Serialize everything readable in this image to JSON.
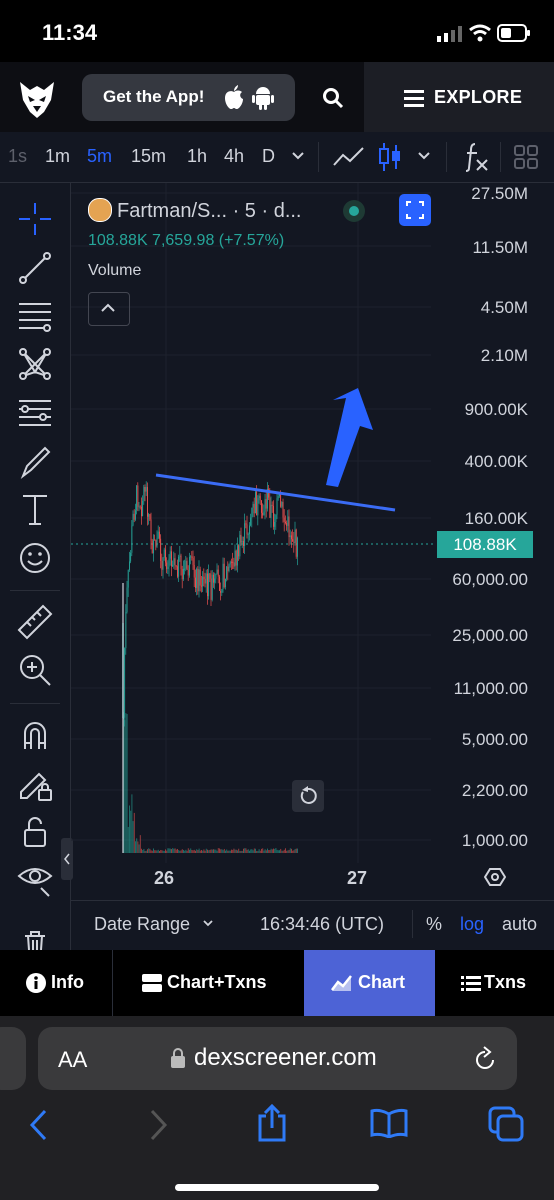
{
  "status_bar": {
    "time": "11:34"
  },
  "header": {
    "get_app_label": "Get the App!",
    "explore_label": "EXPLORE"
  },
  "timeframes": [
    "1s",
    "1m",
    "5m",
    "15m",
    "1h",
    "4h",
    "D"
  ],
  "active_timeframe": "5m",
  "chart": {
    "symbol_title": "Fartman/S... · 5 · d...",
    "value_line": "108.88K  7,659.98 (+7.57%)",
    "volume_label": "Volume",
    "current_price_label": "108.88K",
    "y_tick_labels": [
      "27.50M",
      "11.50M",
      "4.50M",
      "2.10M",
      "900.00K",
      "400.00K",
      "160.00K",
      "60,000.00",
      "25,000.00",
      "11,000.00",
      "5,000.00",
      "2,200.00",
      "1,000.00"
    ],
    "x_tick_labels": [
      "26",
      "27"
    ],
    "accent_color": "#2962ff",
    "up_color": "#26a69a",
    "down_color": "#ef5350"
  },
  "chart_footer": {
    "date_range_label": "Date Range",
    "time_label": "16:34:46 (UTC)",
    "percent_label": "%",
    "log_label": "log",
    "auto_label": "auto"
  },
  "tabs": [
    {
      "label": "Info",
      "icon": "info-icon"
    },
    {
      "label": "Chart+Txns",
      "icon": "split-icon"
    },
    {
      "label": "Chart",
      "icon": "chart-icon",
      "active": true
    },
    {
      "label": "Txns",
      "icon": "list-icon"
    }
  ],
  "browser": {
    "aa_label": "AA",
    "url": "dexscreener.com"
  }
}
